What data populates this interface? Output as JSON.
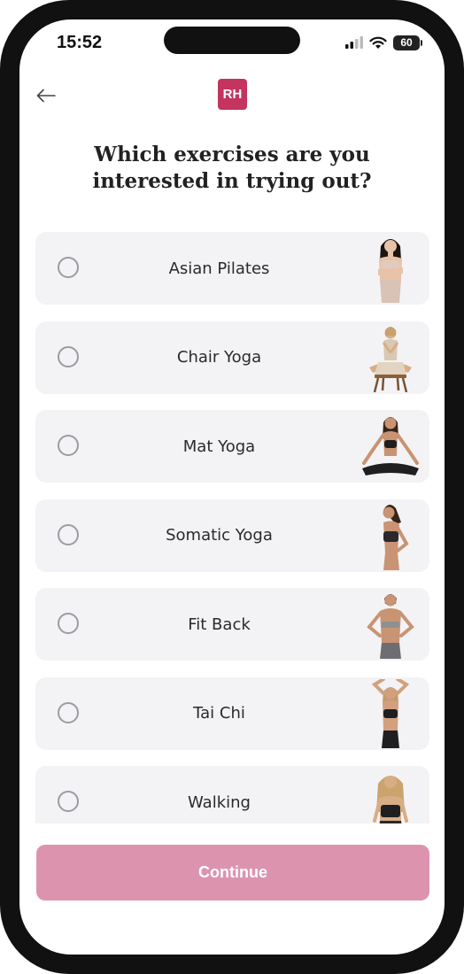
{
  "status_bar": {
    "time": "15:52",
    "battery": "60"
  },
  "header": {
    "logo": "RH"
  },
  "title": {
    "line1": "Which exercises are you",
    "line2": "interested in trying out?"
  },
  "options": [
    {
      "label": "Asian Pilates",
      "selected": false
    },
    {
      "label": "Chair Yoga",
      "selected": false
    },
    {
      "label": "Mat Yoga",
      "selected": false
    },
    {
      "label": "Somatic Yoga",
      "selected": false
    },
    {
      "label": "Fit Back",
      "selected": false
    },
    {
      "label": "Tai Chi",
      "selected": false
    },
    {
      "label": "Walking",
      "selected": false
    }
  ],
  "continue_label": "Continue",
  "colors": {
    "brand": "#c4345f",
    "button": "#dc94ae",
    "option_bg": "#f3f3f6"
  }
}
